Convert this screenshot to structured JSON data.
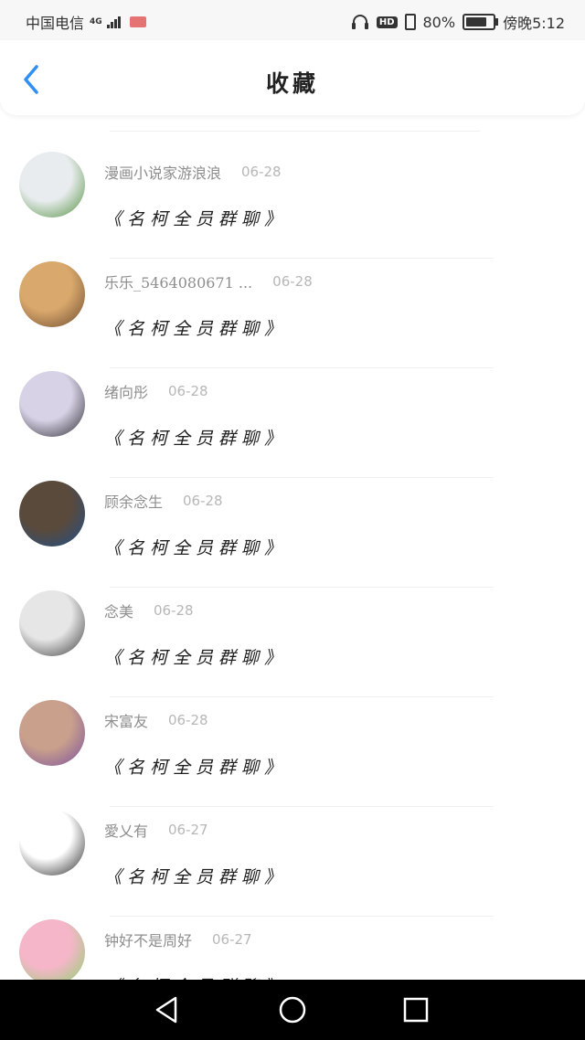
{
  "status_bar": {
    "carrier": "中国电信",
    "network": "4G",
    "battery_text": "80%",
    "time": "傍晚5:12",
    "battery_level": 0.8,
    "icons": [
      "signal-icon",
      "mail-icon",
      "headphone-icon",
      "hd-icon",
      "vibrate-icon",
      "battery-icon"
    ]
  },
  "header": {
    "title": "收藏",
    "back_icon": "chevron-left-icon",
    "accent_color": "#2f8ff5"
  },
  "favorites": [
    {
      "name": "漫画小说家游浪浪",
      "date": "06-28",
      "message": "《名柯全员群聊》",
      "avatar_colors": [
        "#e9ecef",
        "#4e8f3a"
      ]
    },
    {
      "name": "乐乐_5464080671 ...",
      "date": "06-28",
      "message": "《名柯全员群聊》",
      "avatar_colors": [
        "#d9a86c",
        "#6b4a2f"
      ]
    },
    {
      "name": "绪向彤",
      "date": "06-28",
      "message": "《名柯全员群聊》",
      "avatar_colors": [
        "#d8d2e6",
        "#2a2a30"
      ]
    },
    {
      "name": "顾余念生",
      "date": "06-28",
      "message": "《名柯全员群聊》",
      "avatar_colors": [
        "#5a4a3c",
        "#1f4f8a"
      ]
    },
    {
      "name": "念美",
      "date": "06-28",
      "message": "《名柯全员群聊》",
      "avatar_colors": [
        "#e6e6e6",
        "#3a3a3a"
      ]
    },
    {
      "name": "宋富友",
      "date": "06-28",
      "message": "《名柯全员群聊》",
      "avatar_colors": [
        "#c9a08c",
        "#7a4f9e"
      ]
    },
    {
      "name": "愛乂有",
      "date": "06-27",
      "message": "《名柯全员群聊》",
      "avatar_colors": [
        "#ffffff",
        "#222222"
      ]
    },
    {
      "name": "钟好不是周好",
      "date": "06-27",
      "message": "《名柯全员群聊》",
      "avatar_colors": [
        "#f4b6c8",
        "#8bd36b"
      ]
    }
  ],
  "nav_bar": {
    "buttons": [
      "back-triangle-icon",
      "home-circle-icon",
      "recents-square-icon"
    ]
  }
}
